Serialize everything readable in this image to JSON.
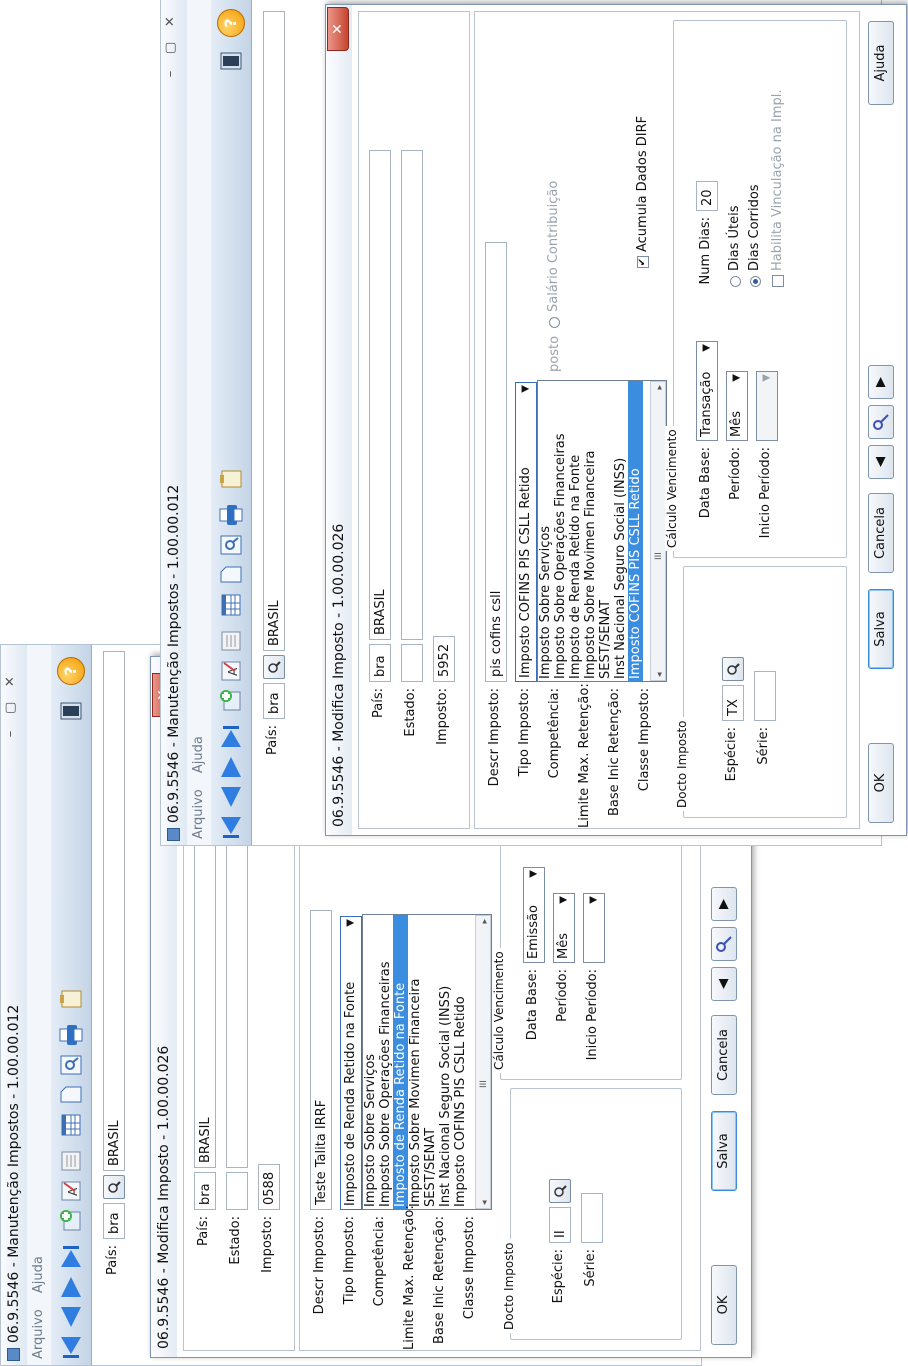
{
  "windows": [
    {
      "title": "06.9.5546 - Manutenção Impostos - 1.00.00.012",
      "menu": [
        "Arquivo",
        "Ajuda"
      ],
      "pais_label": "País:",
      "pais_code": "bra",
      "pais_name": "BRASIL",
      "controls": [
        "–",
        "▢",
        "✕"
      ]
    },
    {
      "title": "06.9.5546 - Manutenção Impostos - 1.00.00.012",
      "menu": [
        "Arquivo",
        "Ajuda"
      ],
      "pais_label": "País:",
      "pais_code": "bra",
      "pais_name": "BRASIL",
      "controls": [
        "–",
        "▢",
        "✕"
      ]
    }
  ],
  "dialogs": [
    {
      "title": "06.9.5546 - Modifica Imposto - 1.00.00.026",
      "labels": {
        "pais": "País:",
        "estado": "Estado:",
        "imposto": "Imposto:",
        "descr": "Descr Imposto:",
        "tipo": "Tipo Imposto:",
        "competencia": "Competência:",
        "limite": "Limite Max. Retenção:",
        "base": "Base Inic Retenção:",
        "classe": "Classe Imposto:",
        "especie": "Espécie:",
        "serie": "Série:",
        "data_base": "Data Base:",
        "periodo": "Período:",
        "inicio_periodo": "Inicio Período:"
      },
      "pais_code": "bra",
      "pais_name": "BRASIL",
      "imposto": "0588",
      "descr": "Teste Talita IRRF",
      "tipo_selected": "Imposto de Renda Retido na Fonte",
      "tipo_options": [
        "Imposto Sobre Serviços",
        "Imposto Sobre Operações Financeiras",
        "Imposto de Renda Retido na Fonte",
        "Imposto Sobre Movimen Financeira",
        "SEST/SENAT",
        "Inst Nacional Seguro Social (INSS)",
        "Imposto COFINS  PIS  CSLL Retido"
      ],
      "highlighted_option": 2,
      "especie": "II",
      "group_docto": "Docto Imposto",
      "group_calc": "Cálculo Vencimento",
      "data_base": "Emissão",
      "periodo": "Mês",
      "buttons": {
        "ok": "OK",
        "salva": "Salva",
        "cancela": "Cancela"
      },
      "scroll_glyph": "III"
    },
    {
      "title": "06.9.5546 - Modifica Imposto - 1.00.00.026",
      "labels": {
        "pais": "País:",
        "estado": "Estado:",
        "imposto": "Imposto:",
        "descr": "Descr Imposto:",
        "tipo": "Tipo Imposto:",
        "competencia": "Competência:",
        "limite": "Limite Max. Retenção:",
        "base": "Base Inic Retenção:",
        "classe": "Classe Imposto:",
        "especie": "Espécie:",
        "serie": "Série:",
        "data_base": "Data Base:",
        "periodo": "Período:",
        "inicio_periodo": "Inicio Período:",
        "num_dias": "Num Dias:"
      },
      "pais_code": "bra",
      "pais_name": "BRASIL",
      "imposto": "5952",
      "descr": "pis cofins csll",
      "tipo_selected": "Imposto COFINS  PIS  CSLL Retido",
      "tipo_options": [
        "Imposto Sobre Serviços",
        "Imposto Sobre Operações Financeiras",
        "Imposto de Renda Retido na Fonte",
        "Imposto Sobre Movimen Financeira",
        "SEST/SENAT",
        "Inst Nacional Seguro Social (INSS)",
        "Imposto COFINS  PIS  CSLL Retido"
      ],
      "highlighted_option": 6,
      "especie": "TX",
      "group_docto": "Docto Imposto",
      "group_calc": "Cálculo Vencimento",
      "data_base": "Transação",
      "periodo": "Mês",
      "num_dias": "20",
      "imposto_partial": "posto",
      "salario_contribuicao": "Salário Contribuição",
      "acumula_dirf": "Acumula Dados DIRF",
      "dias_uteis": "Dias Úteis",
      "dias_corridos": "Dias Corridos",
      "habilita_vinculacao": "Habilita Vinculação na Impl.",
      "buttons": {
        "ok": "OK",
        "salva": "Salva",
        "cancela": "Cancela",
        "ajuda": "Ajuda"
      },
      "scroll_glyph": "III"
    }
  ],
  "colors": {
    "accent": "#3b8de0",
    "close": "#c7442f",
    "help": "#f29a00"
  }
}
